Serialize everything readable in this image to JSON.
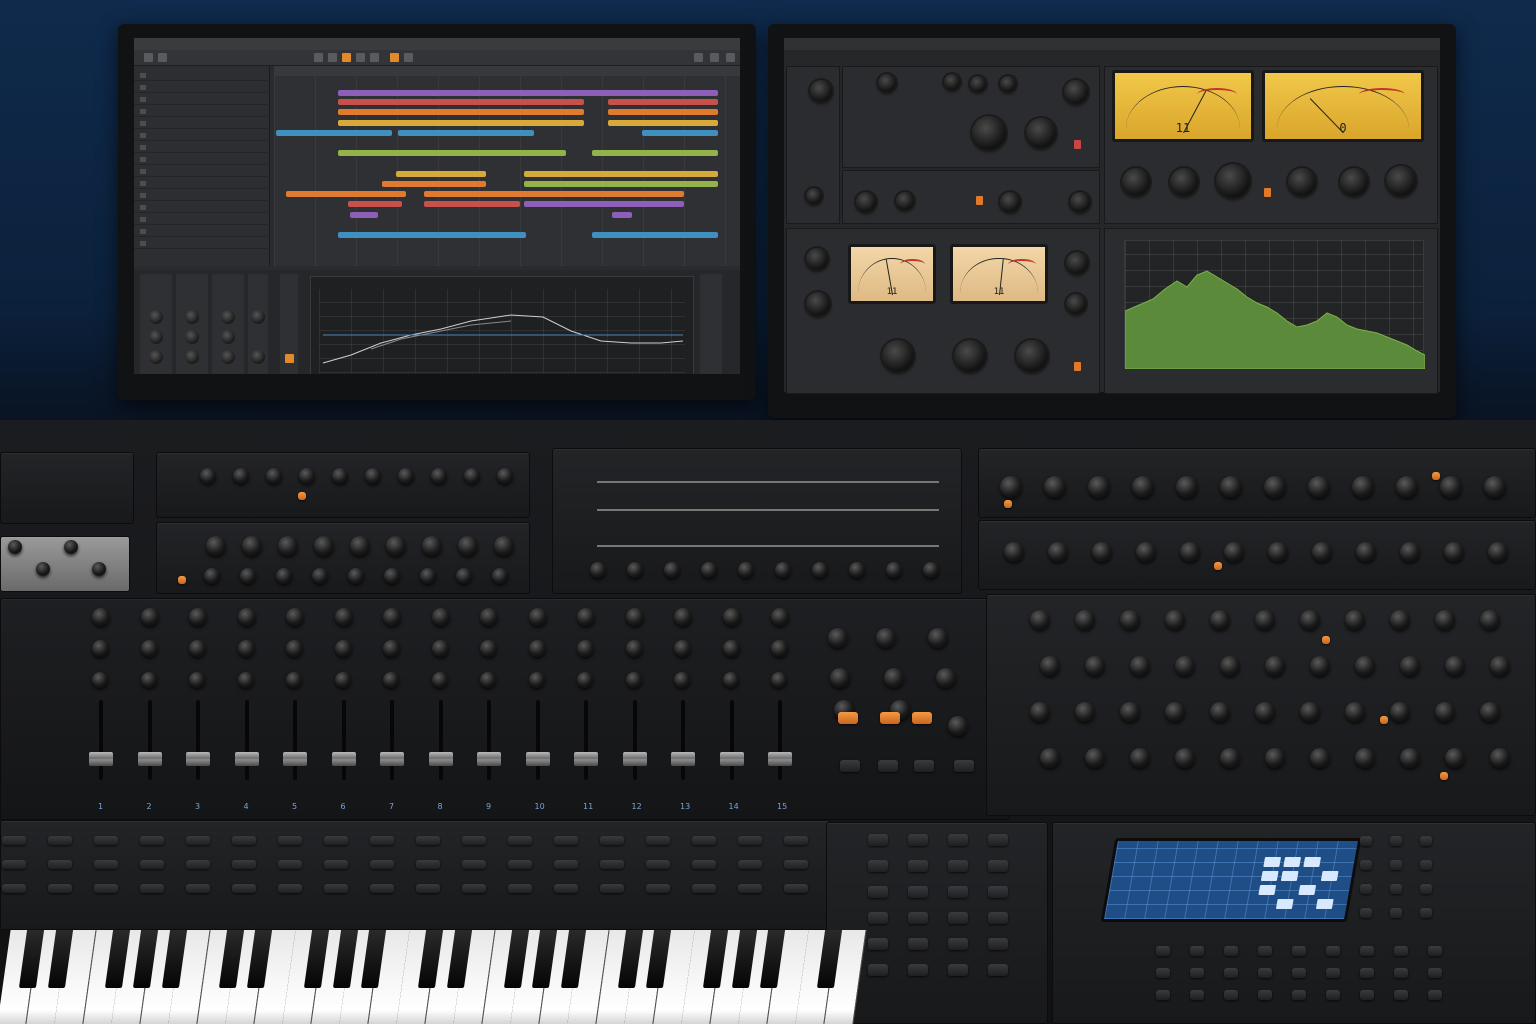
{
  "daw": {
    "title": "",
    "tracks": [
      "",
      "",
      "",
      "",
      "",
      "",
      "",
      "",
      "",
      "",
      "",
      "",
      "",
      "",
      ""
    ]
  },
  "plugins": {
    "vu_left": "11",
    "vu_right": "0",
    "vu_small_left": "11",
    "vu_small_right": "11"
  },
  "console": {
    "channel_numbers": [
      "1",
      "2",
      "3",
      "4",
      "5",
      "6",
      "7",
      "8",
      "9",
      "10",
      "11",
      "12",
      "13",
      "14",
      "15"
    ]
  },
  "colors": {
    "clip_purple": "#8d5fb8",
    "clip_orange": "#e07a2e",
    "clip_yellow": "#d6a93a",
    "clip_green": "#94b24a",
    "clip_blue": "#3f8fbf",
    "clip_red": "#c8504a",
    "accent_orange": "#e08a2a",
    "spectrum_green": "#5a8a3a",
    "pad_blue": "#1f4d86"
  },
  "icons": {
    "vu_meter": "vu-meter-icon",
    "knob": "knob-icon",
    "fader": "fader-icon"
  }
}
